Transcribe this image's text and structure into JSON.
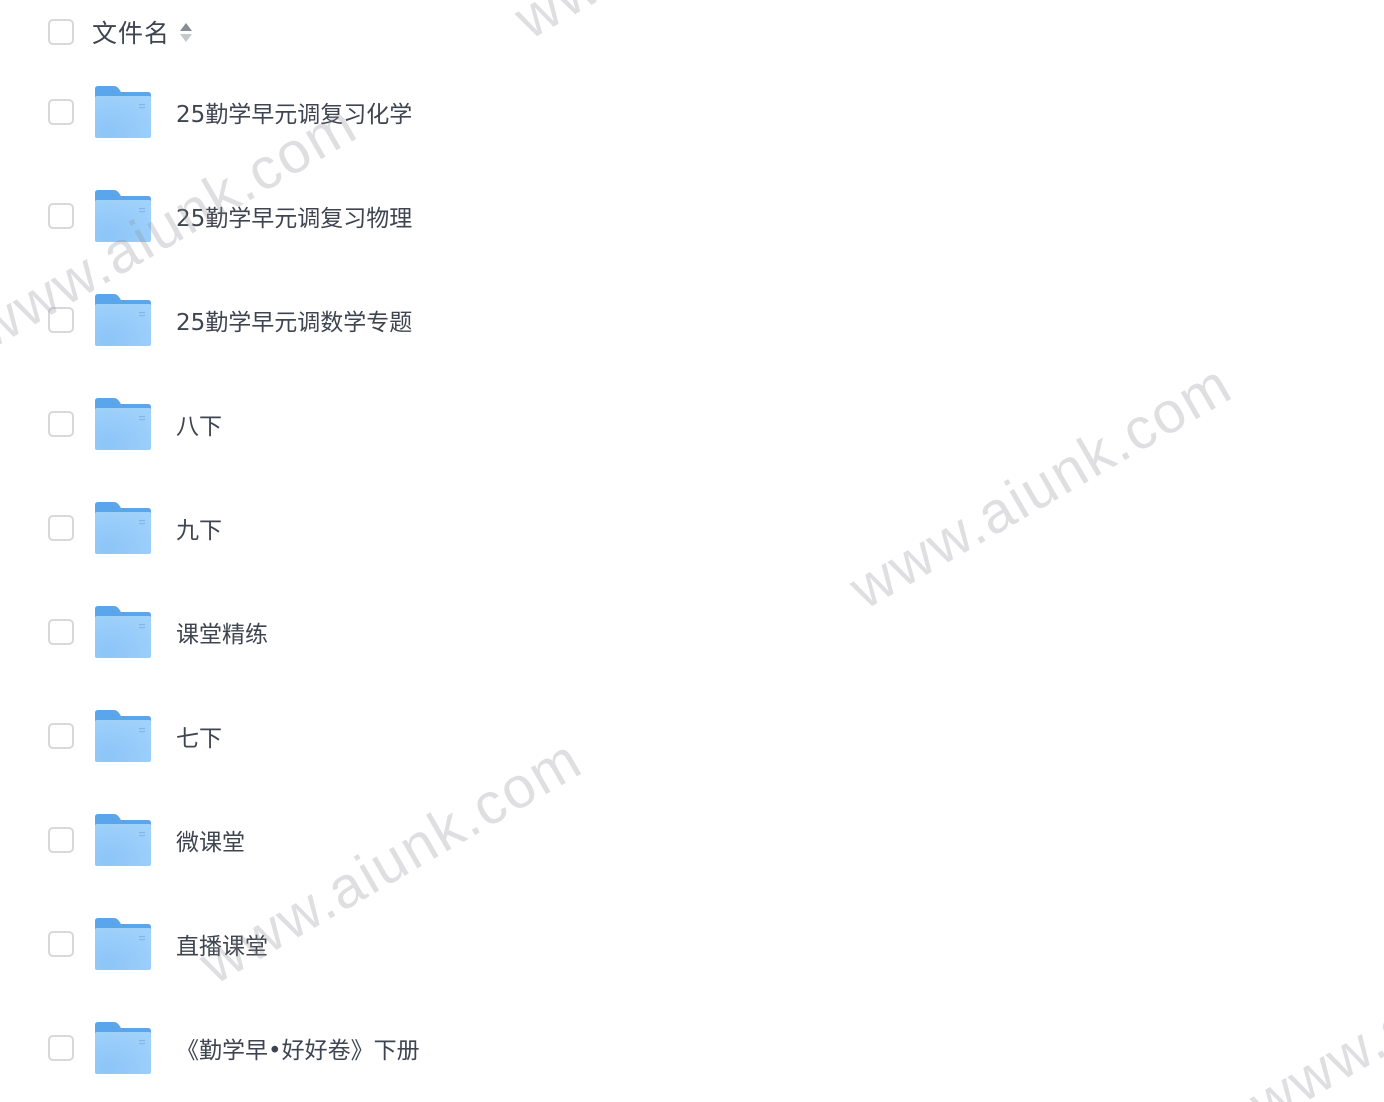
{
  "header": {
    "column_label": "文件名",
    "sort_icon": "sort-toggle-icon"
  },
  "files": [
    {
      "name": "25勤学早元调复习化学",
      "icon": "folder-icon"
    },
    {
      "name": "25勤学早元调复习物理",
      "icon": "folder-icon"
    },
    {
      "name": "25勤学早元调数学专题",
      "icon": "folder-icon"
    },
    {
      "name": "八下",
      "icon": "folder-icon"
    },
    {
      "name": "九下",
      "icon": "folder-icon"
    },
    {
      "name": "课堂精练",
      "icon": "folder-icon"
    },
    {
      "name": "七下",
      "icon": "folder-icon"
    },
    {
      "name": "微课堂",
      "icon": "folder-icon"
    },
    {
      "name": "直播课堂",
      "icon": "folder-icon"
    },
    {
      "name": "《勤学早•好好卷》下册",
      "icon": "folder-icon"
    }
  ],
  "watermark": {
    "text": "www.aiunk.com"
  },
  "colors": {
    "folder_back": "#5aa6ec",
    "folder_front": "#a3d3fb",
    "checkbox_border": "#d6d8dc",
    "text": "#3f4550"
  }
}
